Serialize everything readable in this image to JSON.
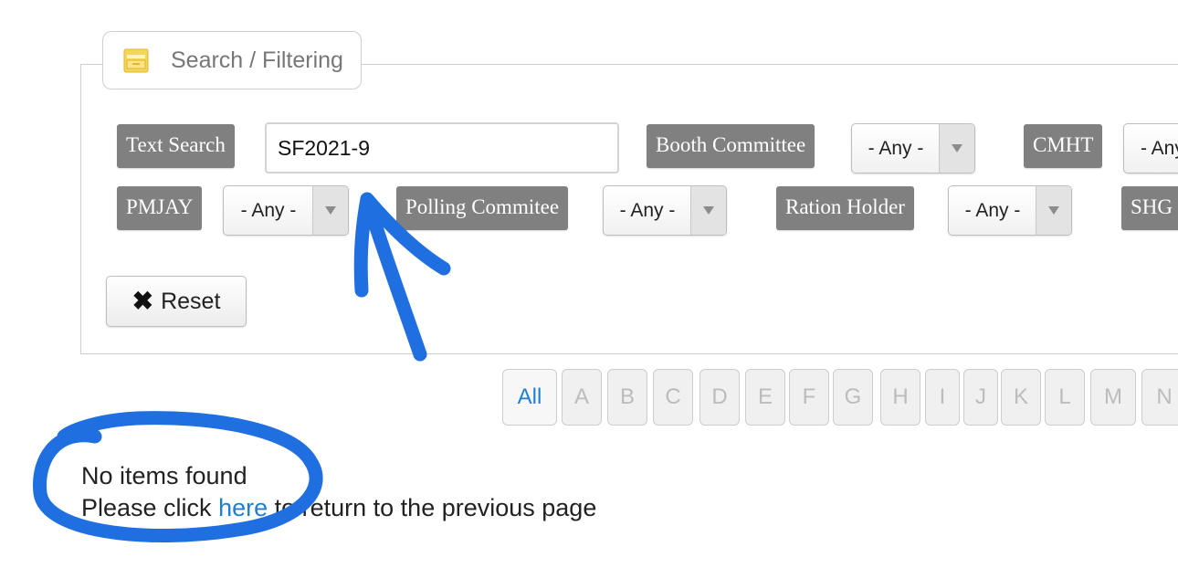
{
  "panel": {
    "title": "Search / Filtering",
    "legend_icon": "folder-icon"
  },
  "filters": {
    "text_search": {
      "label": "Text Search",
      "value": "SF2021-9"
    },
    "booth_committee": {
      "label": "Booth Committee",
      "value": "- Any -"
    },
    "cmht": {
      "label": "CMHT",
      "value": "- Any -"
    },
    "pmjay": {
      "label": "PMJAY",
      "value": "- Any -"
    },
    "polling_commitee": {
      "label": "Polling Commitee",
      "value": "- Any -"
    },
    "ration_holder": {
      "label": "Ration Holder",
      "value": "- Any -"
    },
    "shg": {
      "label": "SHG"
    }
  },
  "reset": {
    "label": "Reset",
    "icon": "close-icon"
  },
  "pager": {
    "items": [
      "All",
      "A",
      "B",
      "C",
      "D",
      "E",
      "F",
      "G",
      "H",
      "I",
      "J",
      "K",
      "L",
      "M",
      "N"
    ],
    "active": "All"
  },
  "message": {
    "line1": "No items found",
    "line2_before": "Please click ",
    "link": "here",
    "line2_after": " to return to the previous page"
  },
  "colors": {
    "label_bg": "#808080",
    "link": "#1f7fd6",
    "annotation": "#1f6fe0"
  }
}
